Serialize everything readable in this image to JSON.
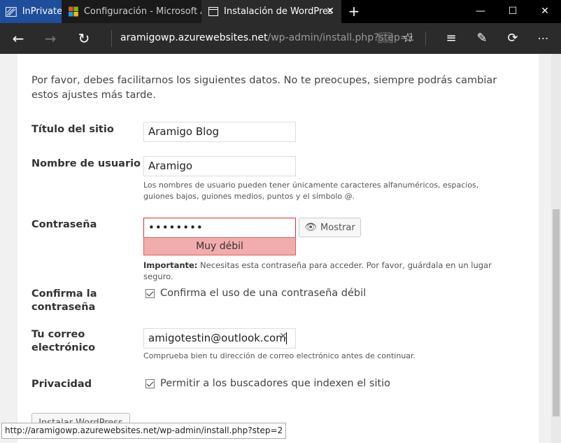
{
  "tabs": {
    "inprivate": "InPrivate",
    "azure": "Configuración - Microsoft Az",
    "wordpress": "Instalación de WordPres"
  },
  "address": {
    "host": "aramigowp.azurewebsites.net",
    "path": "/wp-admin/install.php?step=1"
  },
  "form": {
    "intro": "Por favor, debes facilitarnos los siguientes datos. No te preocupes, siempre podrás cambiar estos ajustes más tarde.",
    "site_title_label": "Título del sitio",
    "site_title_value": "Aramigo Blog",
    "username_label": "Nombre de usuario",
    "username_value": "Aramigo",
    "username_hint": "Los nombres de usuario pueden tener únicamente caracteres alfanuméricos, espacios, guiones bajos, guiones medios, puntos y el símbolo @.",
    "password_label": "Contraseña",
    "password_value": "••••••••",
    "show_label": "Mostrar",
    "strength": "Muy débil",
    "password_hint_bold": "Importante:",
    "password_hint": " Necesitas esta contraseña para acceder. Por favor, guárdala en un lugar seguro.",
    "confirm_label": "Confirma la contraseña",
    "confirm_check": "Confirma el uso de una contraseña débil",
    "email_label": "Tu correo electrónico",
    "email_value": "amigotestin@outlook.com",
    "email_hint": "Comprueba bien tu dirección de correo electrónico antes de continuar.",
    "privacy_label": "Privacidad",
    "privacy_check": "Permitir a los buscadores que indexen el sitio",
    "install_button": "Instalar WordPress"
  },
  "status_url": "http://aramigowp.azurewebsites.net/wp-admin/install.php?step=2"
}
